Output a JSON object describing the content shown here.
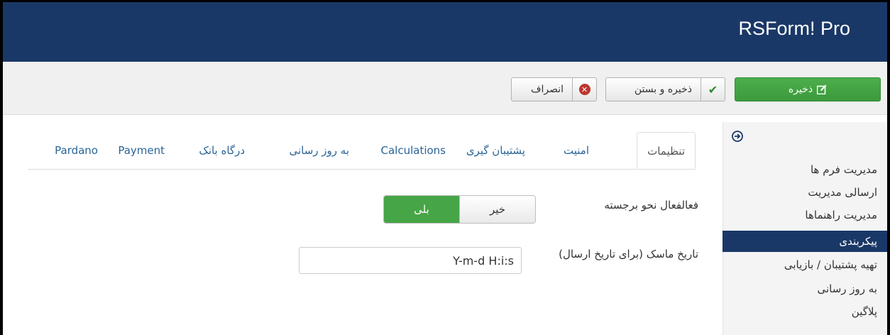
{
  "header": {
    "brand": "RSForm! Pro"
  },
  "toolbar": {
    "save_label": "ذخیره",
    "save_close_label": "ذخیره و بستن",
    "cancel_label": "انصراف"
  },
  "sidebar": {
    "items": [
      {
        "label": "مدیریت فرم ها",
        "active": false
      },
      {
        "label": "ارسالی مدیریت",
        "active": false
      },
      {
        "label": "مدیریت راهنماها",
        "active": false
      },
      {
        "label": "پیکربندی",
        "active": true
      },
      {
        "label": "تهیه پشتیبان / بازیابی",
        "active": false
      },
      {
        "label": "به روز رسانی",
        "active": false
      },
      {
        "label": "پلاگین",
        "active": false
      }
    ]
  },
  "tabs": [
    {
      "label": "تنظیمات",
      "active": true
    },
    {
      "label": "امنیت",
      "active": false
    },
    {
      "label": "پشتیبان گیری",
      "active": false
    },
    {
      "label": "Calculations",
      "active": false
    },
    {
      "label": "به روز رسانی",
      "active": false
    },
    {
      "label": "درگاه بانک",
      "active": false
    },
    {
      "label": "Payment",
      "active": false
    },
    {
      "label": "Pardano",
      "active": false
    }
  ],
  "settings": {
    "bold_label": "فعالفعال نحو برجسته",
    "toggle_yes": "بلی",
    "toggle_no": "خیر",
    "toggle_value": "بلی",
    "date_mask_label": "تاریخ ماسک (برای تاریخ ارسال)",
    "date_mask_value": "Y-m-d H:i:s"
  },
  "colors": {
    "header": "#1a3867",
    "save_button": "#46a546",
    "toggle_active": "#46a546",
    "link": "#2a6496"
  }
}
